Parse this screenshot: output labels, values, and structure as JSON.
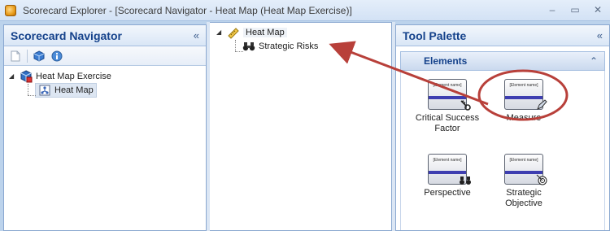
{
  "window": {
    "title": "Scorecard Explorer - [Scorecard Navigator - Heat Map (Heat Map Exercise)]",
    "controls": [
      "–",
      "▭",
      "✕"
    ]
  },
  "navigator": {
    "title": "Scorecard Navigator",
    "collapse_glyph": "«",
    "toolbar_icons": [
      "new-page-icon",
      "cube-icon",
      "info-icon"
    ],
    "tree": [
      {
        "label": "Heat Map Exercise",
        "icon": "cube-icon",
        "expanded": true
      },
      {
        "label": "Heat Map",
        "icon": "heatmap-icon",
        "selected": true
      }
    ]
  },
  "center_tree": {
    "expander": "◢",
    "items": [
      {
        "label": "Heat Map",
        "icon": "ruler-icon"
      },
      {
        "label": "Strategic Risks",
        "icon": "binoculars-icon"
      }
    ]
  },
  "palette": {
    "title": "Tool Palette",
    "collapse_glyph": "«",
    "group_title": "Elements",
    "group_chevron": "⌃",
    "card_label": "[Element name]",
    "items": [
      {
        "label_line1": "Critical Success",
        "label_line2": "Factor",
        "glyph": "key-icon"
      },
      {
        "label_line1": "Measure",
        "label_line2": "",
        "glyph": "pencil-icon",
        "highlighted": true
      },
      {
        "label_line1": "Perspective",
        "label_line2": "",
        "glyph": "binoculars-icon"
      },
      {
        "label_line1": "Strategic",
        "label_line2": "Objective",
        "glyph": "target-icon"
      }
    ]
  },
  "colors": {
    "header_text": "#15428b",
    "annotation_red": "#b8403a",
    "card_band": "#3e3eb0"
  }
}
